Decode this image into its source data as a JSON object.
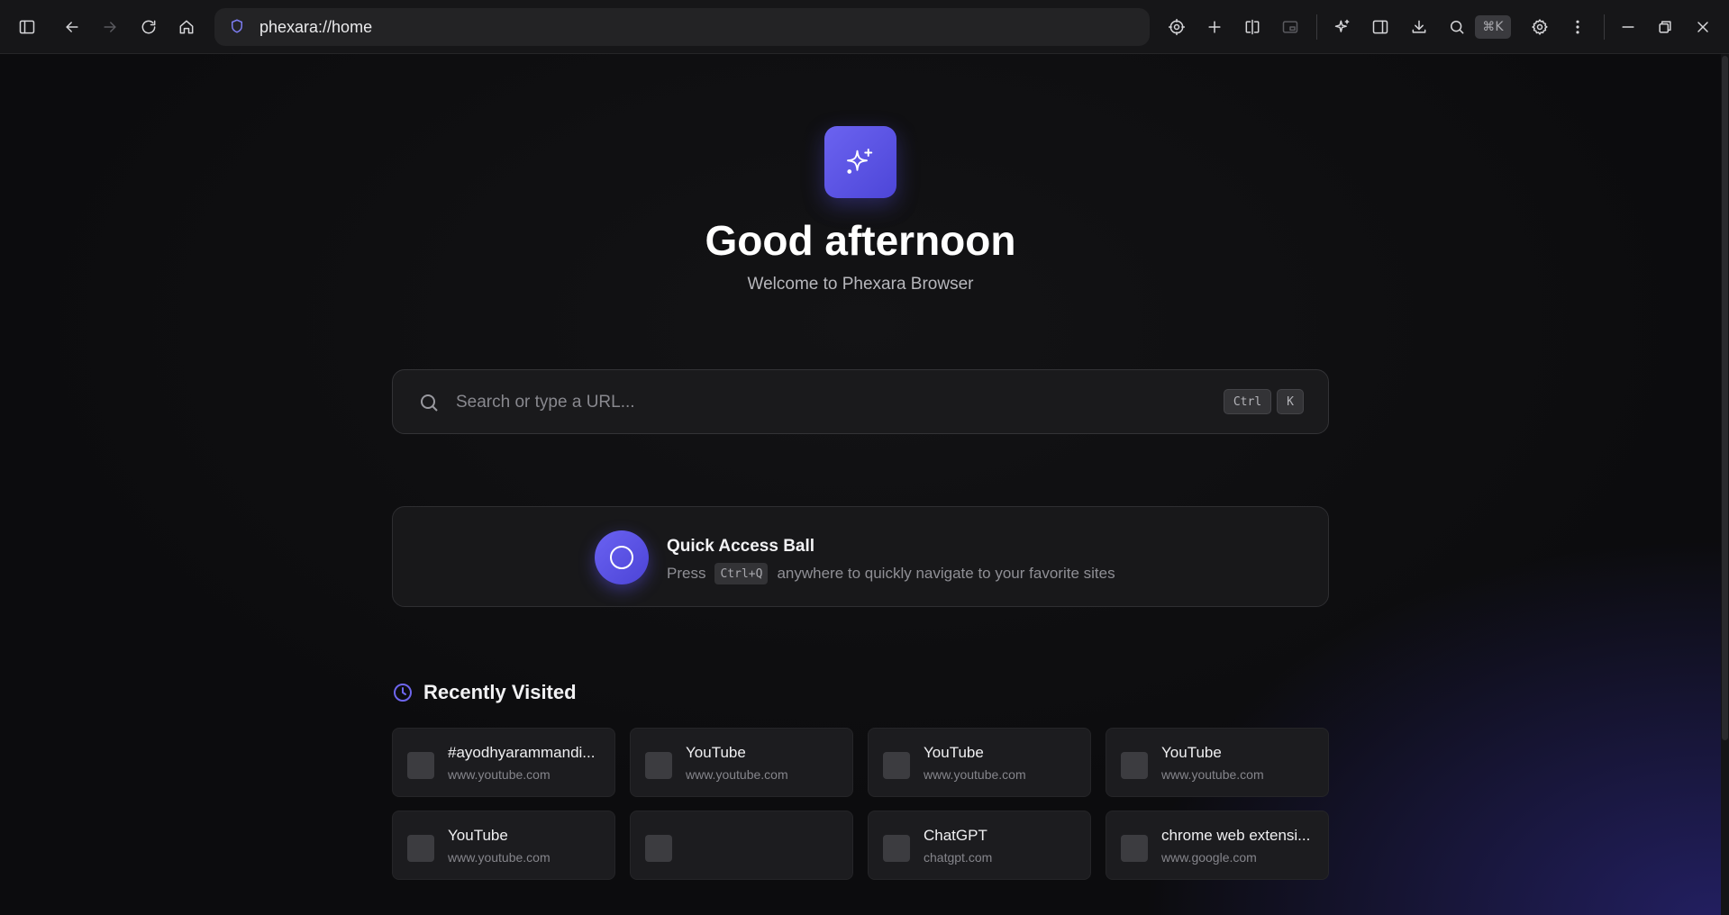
{
  "browser": {
    "url": "phexara://home",
    "shortcut_pill": "⌘K"
  },
  "home": {
    "greeting": "Good afternoon",
    "welcome": "Welcome to Phexara Browser",
    "search": {
      "placeholder": "Search or type a URL...",
      "key1": "Ctrl",
      "key2": "K"
    },
    "quick_access": {
      "title": "Quick Access Ball",
      "desc_prefix": "Press",
      "shortcut": "Ctrl+Q",
      "desc_suffix": "anywhere to quickly navigate to your favorite sites"
    },
    "recently_visited": {
      "title": "Recently Visited",
      "items": [
        {
          "title": "#ayodhyarammandi...",
          "url": "www.youtube.com"
        },
        {
          "title": "YouTube",
          "url": "www.youtube.com"
        },
        {
          "title": "YouTube",
          "url": "www.youtube.com"
        },
        {
          "title": "YouTube",
          "url": "www.youtube.com"
        },
        {
          "title": "YouTube",
          "url": "www.youtube.com"
        },
        {
          "title": "",
          "url": ""
        },
        {
          "title": "ChatGPT",
          "url": "chatgpt.com"
        },
        {
          "title": "chrome web extensi...",
          "url": "www.google.com"
        }
      ]
    }
  },
  "colors": {
    "accent": "#5b54e6",
    "background": "#0d0d0f",
    "toolbar": "#161618"
  }
}
